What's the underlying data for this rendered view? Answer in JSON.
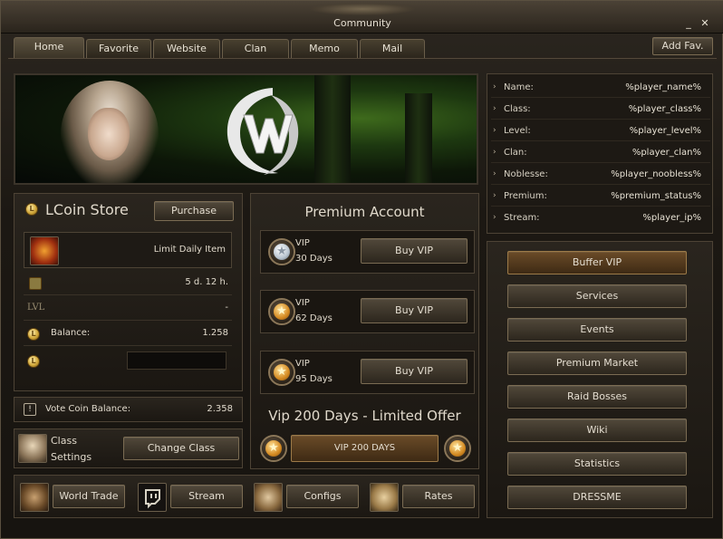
{
  "window": {
    "title": "Community",
    "close_glyph": "✕",
    "min_glyph": "_"
  },
  "tabs": [
    {
      "label": "Home",
      "active": true
    },
    {
      "label": "Favorite"
    },
    {
      "label": "Website"
    },
    {
      "label": "Clan"
    },
    {
      "label": "Memo"
    },
    {
      "label": "Mail"
    }
  ],
  "add_fav_label": "Add Fav.",
  "player_info": [
    {
      "label": "Name:",
      "value": "%player_name%"
    },
    {
      "label": "Class:",
      "value": "%player_class%"
    },
    {
      "label": "Level:",
      "value": "%player_level%"
    },
    {
      "label": "Clan:",
      "value": "%player_clan%"
    },
    {
      "label": "Noblesse:",
      "value": "%player_noobless%"
    },
    {
      "label": "Premium:",
      "value": "%premium_status%"
    },
    {
      "label": "Stream:",
      "value": "%player_ip%"
    }
  ],
  "lcoin_store": {
    "title": "LCoin Store",
    "purchase_label": "Purchase",
    "item_name": "Limit Daily Item",
    "time_left": "5 d. 12 h.",
    "level_label": "LVL",
    "level_value": "-",
    "balance_label": "Balance:",
    "balance_value": "1.258"
  },
  "vote": {
    "label": "Vote Coin Balance:",
    "value": "2.358"
  },
  "class_settings": {
    "label_line1": "Class",
    "label_line2": "Settings",
    "button": "Change Class"
  },
  "premium": {
    "title": "Premium Account",
    "options": [
      {
        "name": "VIP",
        "duration": "30 Days",
        "button": "Buy VIP",
        "coin": "silver"
      },
      {
        "name": "VIP",
        "duration": "62 Days",
        "button": "Buy VIP",
        "coin": "gold"
      },
      {
        "name": "VIP",
        "duration": "95 Days",
        "button": "Buy VIP",
        "coin": "gold"
      }
    ],
    "offer_title": "Vip 200 Days - Limited Offer",
    "offer_button": "VIP 200 DAYS"
  },
  "bottom_links": [
    {
      "label": "World Trade",
      "icon": "backpack-icon"
    },
    {
      "label": "Stream",
      "icon": "twitch-icon"
    },
    {
      "label": "Configs",
      "icon": "book-icon"
    },
    {
      "label": "Rates",
      "icon": "horn-icon"
    }
  ],
  "side_menu": [
    {
      "label": "Buffer VIP",
      "highlighted": true
    },
    {
      "label": "Services"
    },
    {
      "label": "Events"
    },
    {
      "label": "Premium Market"
    },
    {
      "label": "Raid Bosses"
    },
    {
      "label": "Wiki"
    },
    {
      "label": "Statistics"
    },
    {
      "label": "DRESSME"
    }
  ],
  "colors": {
    "accent": "#9c7a48",
    "panel_bg": "#1d1914",
    "text": "#e4ddd0",
    "gold": "#d2a83a"
  }
}
